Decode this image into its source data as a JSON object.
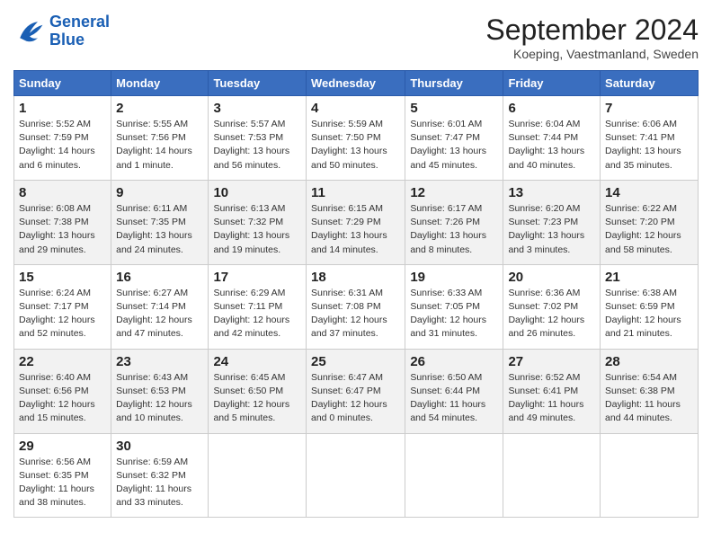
{
  "logo": {
    "text_general": "General",
    "text_blue": "Blue"
  },
  "title": "September 2024",
  "subtitle": "Koeping, Vaestmanland, Sweden",
  "header_days": [
    "Sunday",
    "Monday",
    "Tuesday",
    "Wednesday",
    "Thursday",
    "Friday",
    "Saturday"
  ],
  "weeks": [
    [
      {
        "day": "1",
        "sunrise": "Sunrise: 5:52 AM",
        "sunset": "Sunset: 7:59 PM",
        "daylight": "Daylight: 14 hours and 6 minutes."
      },
      {
        "day": "2",
        "sunrise": "Sunrise: 5:55 AM",
        "sunset": "Sunset: 7:56 PM",
        "daylight": "Daylight: 14 hours and 1 minute."
      },
      {
        "day": "3",
        "sunrise": "Sunrise: 5:57 AM",
        "sunset": "Sunset: 7:53 PM",
        "daylight": "Daylight: 13 hours and 56 minutes."
      },
      {
        "day": "4",
        "sunrise": "Sunrise: 5:59 AM",
        "sunset": "Sunset: 7:50 PM",
        "daylight": "Daylight: 13 hours and 50 minutes."
      },
      {
        "day": "5",
        "sunrise": "Sunrise: 6:01 AM",
        "sunset": "Sunset: 7:47 PM",
        "daylight": "Daylight: 13 hours and 45 minutes."
      },
      {
        "day": "6",
        "sunrise": "Sunrise: 6:04 AM",
        "sunset": "Sunset: 7:44 PM",
        "daylight": "Daylight: 13 hours and 40 minutes."
      },
      {
        "day": "7",
        "sunrise": "Sunrise: 6:06 AM",
        "sunset": "Sunset: 7:41 PM",
        "daylight": "Daylight: 13 hours and 35 minutes."
      }
    ],
    [
      {
        "day": "8",
        "sunrise": "Sunrise: 6:08 AM",
        "sunset": "Sunset: 7:38 PM",
        "daylight": "Daylight: 13 hours and 29 minutes."
      },
      {
        "day": "9",
        "sunrise": "Sunrise: 6:11 AM",
        "sunset": "Sunset: 7:35 PM",
        "daylight": "Daylight: 13 hours and 24 minutes."
      },
      {
        "day": "10",
        "sunrise": "Sunrise: 6:13 AM",
        "sunset": "Sunset: 7:32 PM",
        "daylight": "Daylight: 13 hours and 19 minutes."
      },
      {
        "day": "11",
        "sunrise": "Sunrise: 6:15 AM",
        "sunset": "Sunset: 7:29 PM",
        "daylight": "Daylight: 13 hours and 14 minutes."
      },
      {
        "day": "12",
        "sunrise": "Sunrise: 6:17 AM",
        "sunset": "Sunset: 7:26 PM",
        "daylight": "Daylight: 13 hours and 8 minutes."
      },
      {
        "day": "13",
        "sunrise": "Sunrise: 6:20 AM",
        "sunset": "Sunset: 7:23 PM",
        "daylight": "Daylight: 13 hours and 3 minutes."
      },
      {
        "day": "14",
        "sunrise": "Sunrise: 6:22 AM",
        "sunset": "Sunset: 7:20 PM",
        "daylight": "Daylight: 12 hours and 58 minutes."
      }
    ],
    [
      {
        "day": "15",
        "sunrise": "Sunrise: 6:24 AM",
        "sunset": "Sunset: 7:17 PM",
        "daylight": "Daylight: 12 hours and 52 minutes."
      },
      {
        "day": "16",
        "sunrise": "Sunrise: 6:27 AM",
        "sunset": "Sunset: 7:14 PM",
        "daylight": "Daylight: 12 hours and 47 minutes."
      },
      {
        "day": "17",
        "sunrise": "Sunrise: 6:29 AM",
        "sunset": "Sunset: 7:11 PM",
        "daylight": "Daylight: 12 hours and 42 minutes."
      },
      {
        "day": "18",
        "sunrise": "Sunrise: 6:31 AM",
        "sunset": "Sunset: 7:08 PM",
        "daylight": "Daylight: 12 hours and 37 minutes."
      },
      {
        "day": "19",
        "sunrise": "Sunrise: 6:33 AM",
        "sunset": "Sunset: 7:05 PM",
        "daylight": "Daylight: 12 hours and 31 minutes."
      },
      {
        "day": "20",
        "sunrise": "Sunrise: 6:36 AM",
        "sunset": "Sunset: 7:02 PM",
        "daylight": "Daylight: 12 hours and 26 minutes."
      },
      {
        "day": "21",
        "sunrise": "Sunrise: 6:38 AM",
        "sunset": "Sunset: 6:59 PM",
        "daylight": "Daylight: 12 hours and 21 minutes."
      }
    ],
    [
      {
        "day": "22",
        "sunrise": "Sunrise: 6:40 AM",
        "sunset": "Sunset: 6:56 PM",
        "daylight": "Daylight: 12 hours and 15 minutes."
      },
      {
        "day": "23",
        "sunrise": "Sunrise: 6:43 AM",
        "sunset": "Sunset: 6:53 PM",
        "daylight": "Daylight: 12 hours and 10 minutes."
      },
      {
        "day": "24",
        "sunrise": "Sunrise: 6:45 AM",
        "sunset": "Sunset: 6:50 PM",
        "daylight": "Daylight: 12 hours and 5 minutes."
      },
      {
        "day": "25",
        "sunrise": "Sunrise: 6:47 AM",
        "sunset": "Sunset: 6:47 PM",
        "daylight": "Daylight: 12 hours and 0 minutes."
      },
      {
        "day": "26",
        "sunrise": "Sunrise: 6:50 AM",
        "sunset": "Sunset: 6:44 PM",
        "daylight": "Daylight: 11 hours and 54 minutes."
      },
      {
        "day": "27",
        "sunrise": "Sunrise: 6:52 AM",
        "sunset": "Sunset: 6:41 PM",
        "daylight": "Daylight: 11 hours and 49 minutes."
      },
      {
        "day": "28",
        "sunrise": "Sunrise: 6:54 AM",
        "sunset": "Sunset: 6:38 PM",
        "daylight": "Daylight: 11 hours and 44 minutes."
      }
    ],
    [
      {
        "day": "29",
        "sunrise": "Sunrise: 6:56 AM",
        "sunset": "Sunset: 6:35 PM",
        "daylight": "Daylight: 11 hours and 38 minutes."
      },
      {
        "day": "30",
        "sunrise": "Sunrise: 6:59 AM",
        "sunset": "Sunset: 6:32 PM",
        "daylight": "Daylight: 11 hours and 33 minutes."
      },
      null,
      null,
      null,
      null,
      null
    ]
  ]
}
